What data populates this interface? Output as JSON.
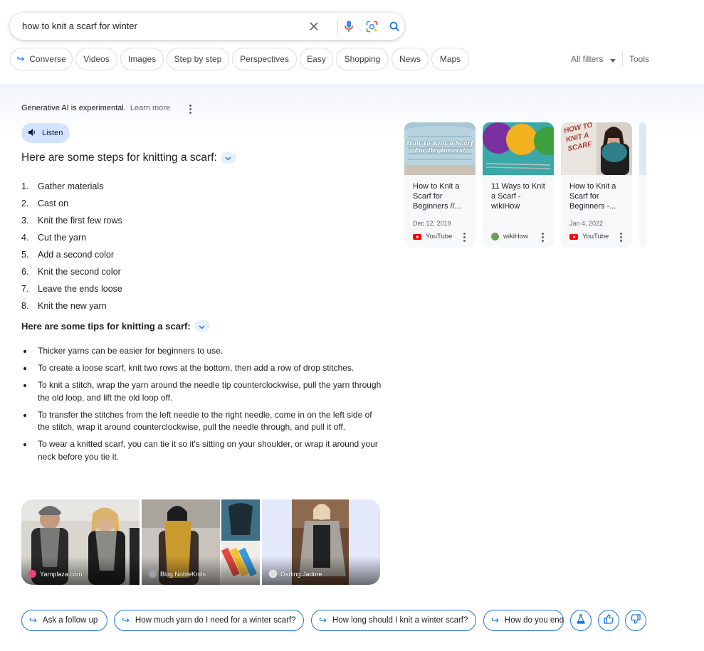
{
  "search": {
    "query": "how to knit a scarf for winter",
    "icons": [
      "close-icon",
      "mic-icon",
      "lens-icon",
      "search-icon"
    ]
  },
  "filters": {
    "chips": [
      "Converse",
      "Videos",
      "Images",
      "Step by step",
      "Perspectives",
      "Easy",
      "Shopping",
      "News",
      "Maps"
    ],
    "all_filters": "All filters",
    "tools": "Tools"
  },
  "ai": {
    "notice": "Generative AI is experimental.",
    "learn_more": "Learn more",
    "listen": "Listen",
    "steps_title": "Here are some steps for knitting a scarf:",
    "steps": [
      "Gather materials",
      "Cast on",
      "Knit the first few rows",
      "Cut the yarn",
      "Add a second color",
      "Knit the second color",
      "Leave the ends loose",
      "Knit the new yarn"
    ],
    "tips_title": "Here are some tips for knitting a scarf:",
    "tips": [
      "Thicker yarns can be easier for beginners to use.",
      "To create a loose scarf, knit two rows at the bottom, then add a row of drop stitches.",
      "To knit a stitch, wrap the yarn around the needle tip counterclockwise, pull the yarn through the old loop, and lift the old loop off.",
      "To transfer the stitches from the left needle to the right needle, come in on the left side of the stitch, wrap it around counterclockwise, pull the needle through, and pull it off.",
      "To wear a knitted scarf, you can tie it so it's sitting on your shoulder, or wrap it around your neck before you tie it."
    ],
    "images": [
      {
        "source": "Yarnplaza.com"
      },
      {
        "source": "Blog.NobleKnits"
      },
      {
        "source": "Darling Jadore"
      }
    ],
    "sources": [
      {
        "title": "How to Knit a Scarf for Beginners //...",
        "date": "Dec 12, 2019",
        "site": "YouTube",
        "thumb_text": "How to Knit a Scarf For Beginners!"
      },
      {
        "title": "11 Ways to Knit a Scarf - wikiHow",
        "date": "",
        "site": "wikiHow"
      },
      {
        "title": "How to Knit a Scarf for Beginners -...",
        "date": "Jan 4, 2022",
        "site": "YouTube",
        "thumb_text": "HOW TO KNIT A SCARF"
      }
    ],
    "followups": [
      "Ask a follow up",
      "How much yarn do I need for a winter scarf?",
      "How long should I knit a winter scarf?",
      "How do you end"
    ]
  },
  "colors": {
    "accent": "#1a73e8",
    "listen_bg": "#d3e3fd",
    "panel_bg": "#f1f4fb"
  }
}
